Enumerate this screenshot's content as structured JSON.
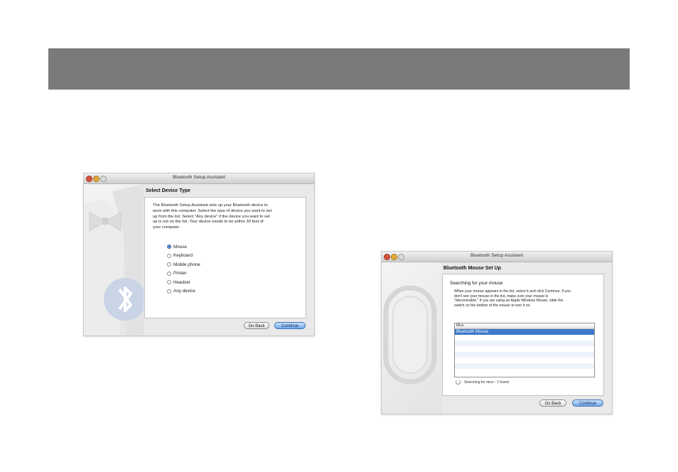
{
  "window_left": {
    "title": "Bluetooth Setup Assistant",
    "section_title": "Select Device Type",
    "description": [
      "The Bluetooth Setup Assistant sets up your Bluetooth device to",
      "work with this computer. Select the type of device you want to set",
      "up from the list. Select \"Any device\" if the device you want to set",
      "up is not on the list. Your device needs to be within 30 feet of",
      "your computer."
    ],
    "options": [
      "Mouse",
      "Keyboard",
      "Mobile phone",
      "Printer",
      "Headset",
      "Any device"
    ],
    "selected_option": "Mouse",
    "go_back_label": "Go Back",
    "continue_label": "Continue"
  },
  "window_right": {
    "title": "Bluetooth Setup Assistant",
    "section_title": "Bluetooth Mouse Set Up",
    "sub_heading": "Searching for your mouse",
    "description": [
      "When your mouse appears in the list, select it and click Continue. If you",
      "don't see your mouse in the list, make sure your mouse is",
      "\"discoverable.\" If you are using an Apple Wireless Mouse, slide the",
      "switch on the bottom of the mouse to turn it on."
    ],
    "list_header": "Mice",
    "list_items": [
      "Bluetooth Mouse"
    ],
    "status": "Searching for mice - 1 found.",
    "go_back_label": "Go Back",
    "continue_label": "Continue"
  },
  "colors": {
    "banner": "#7a7b79",
    "selection": "#3e78c9",
    "continue_button": "#6fa8e8"
  },
  "icons": [
    "close-icon",
    "minimize-icon",
    "zoom-icon",
    "bluetooth-icon",
    "bowtie-icon",
    "mouse-icon",
    "spinner-icon"
  ]
}
